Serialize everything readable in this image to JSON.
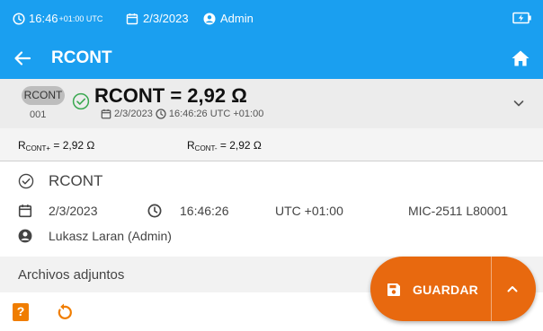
{
  "status_bar": {
    "time": "16:46",
    "timezone": "+01:00 UTC",
    "date": "2/3/2023",
    "user": "Admin"
  },
  "app_bar": {
    "title": "RCONT"
  },
  "result_card": {
    "badge": "RCONT",
    "record_number": "001",
    "main_value": "RCONT = 2,92 Ω",
    "date": "2/3/2023",
    "time": "16:46:26 UTC +01:00"
  },
  "sub_values": {
    "plus_label": "R",
    "plus_sub": "CONT+",
    "plus_value": " = 2,92 Ω",
    "minus_label": "R",
    "minus_sub": "CONT-",
    "minus_value": " = 2,92 Ω"
  },
  "details": {
    "title": "RCONT",
    "date": "2/3/2023",
    "time": "16:46:26",
    "timezone": "UTC +01:00",
    "device": "MIC-2511 L80001",
    "user": "Lukasz Laran (Admin)"
  },
  "attachments": {
    "label": "Archivos adjuntos"
  },
  "fab": {
    "label": "GUARDAR"
  },
  "colors": {
    "header_blue": "#1a9ff0",
    "accent_orange": "#e8690f",
    "success_green": "#3aa850"
  },
  "icons": [
    "clock-icon",
    "calendar-icon",
    "user-icon",
    "battery-charging-icon",
    "back-arrow-icon",
    "home-icon",
    "check-circle-icon",
    "chevron-down-icon",
    "save-icon",
    "chevron-up-icon",
    "help-icon",
    "undo-icon"
  ]
}
